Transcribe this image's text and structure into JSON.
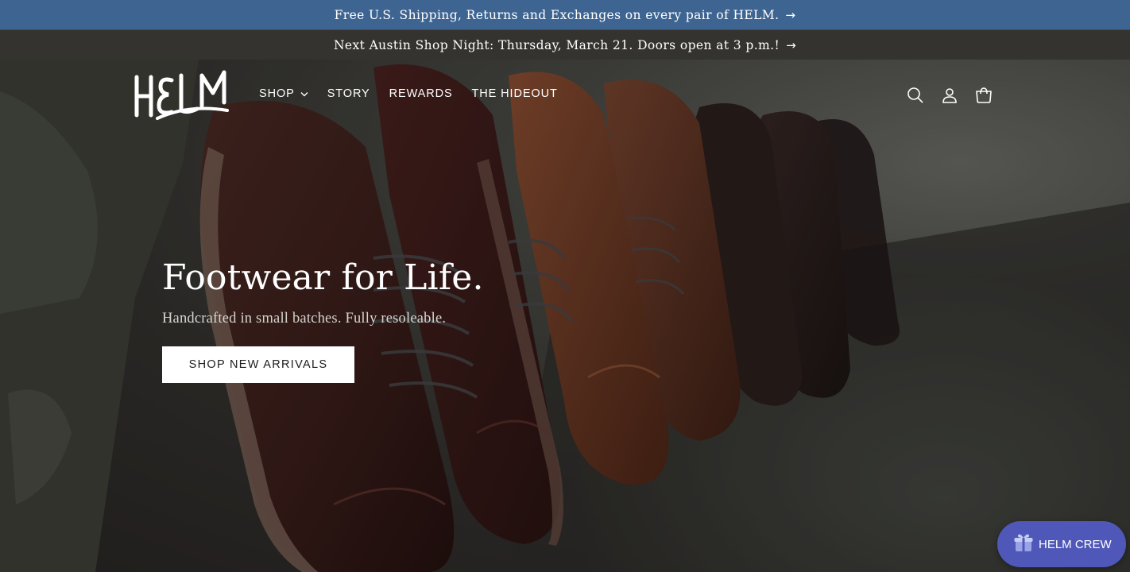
{
  "announcements": [
    {
      "text": "Free U.S. Shipping, Returns and Exchanges on every pair of HELM.",
      "arrow": "→"
    },
    {
      "text": "Next Austin Shop Night: Thursday, March 21. Doors open at 3 p.m.!",
      "arrow": "→"
    }
  ],
  "header": {
    "logo_text": "HELM",
    "nav": [
      {
        "label": "SHOP",
        "has_dropdown": true
      },
      {
        "label": "STORY"
      },
      {
        "label": "REWARDS"
      },
      {
        "label": "THE HIDEOUT"
      }
    ],
    "icons": [
      "search-icon",
      "account-icon",
      "cart-icon"
    ]
  },
  "hero": {
    "title": "Footwear for Life.",
    "subtitle": "Handcrafted in small batches. Fully resoleable.",
    "cta_label": "SHOP NEW ARRIVALS"
  },
  "rewards_widget": {
    "label": "HELM CREW",
    "icon": "gift-icon"
  },
  "colors": {
    "announcement_primary": "#3e6592",
    "announcement_secondary": "#343330",
    "widget": "#4f58b8"
  }
}
